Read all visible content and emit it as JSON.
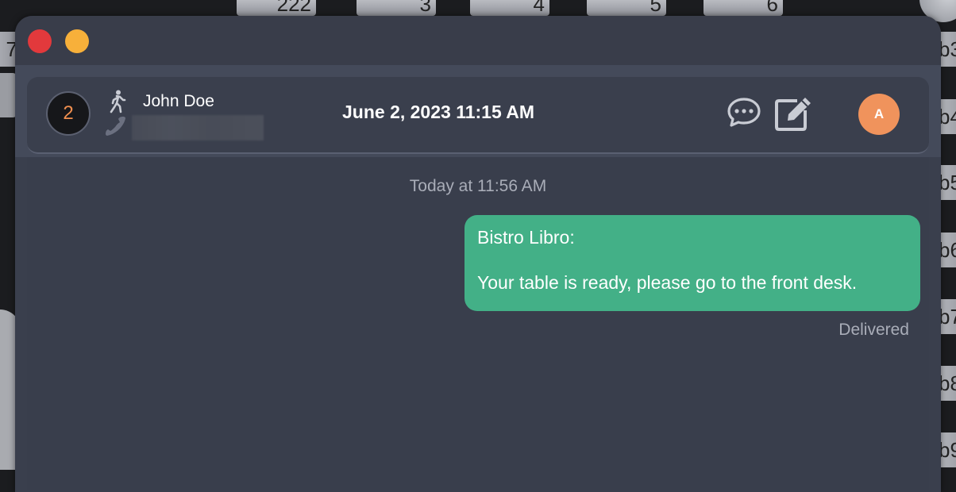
{
  "background": {
    "top_tables": [
      "222",
      "3",
      "4",
      "5",
      "6"
    ],
    "left_tables": [
      "7"
    ],
    "right_tables": [
      "b3",
      "b4",
      "b5",
      "b6",
      "b7",
      "b8",
      "b9"
    ]
  },
  "header": {
    "party_size": "2",
    "guest_name": "John Doe",
    "reservation_time": "June 2, 2023 11:15 AM",
    "avatar_initial": "A"
  },
  "conversation": {
    "timestamp": "Today at 11:56 AM",
    "messages": [
      {
        "sender": "Bistro Libro:",
        "text": "Your table is ready, please go to the front desk.",
        "status": "Delivered"
      }
    ]
  },
  "colors": {
    "window_background": "#3a3f4d",
    "bubble": "#43b087",
    "party_badge_text": "#f08f4f",
    "avatar": "#f0935c",
    "close_button": "#e2393c",
    "minimize_button": "#f7b03a"
  },
  "icons": {
    "walk_in": "walking-person-icon",
    "phone": "phone-icon",
    "chat": "chat-bubble-icon",
    "edit": "edit-icon"
  }
}
